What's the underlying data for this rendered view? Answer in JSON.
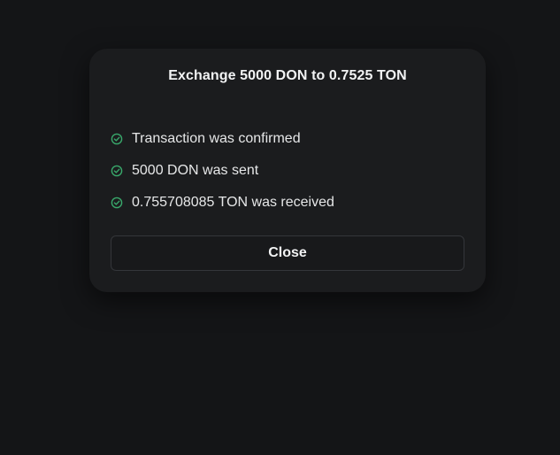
{
  "modal": {
    "title": "Exchange 5000 DON to 0.7525 TON",
    "statuses": [
      {
        "icon": "check-circle-icon",
        "text": "Transaction was confirmed"
      },
      {
        "icon": "check-circle-icon",
        "text": "5000 DON was sent"
      },
      {
        "icon": "check-circle-icon",
        "text": "0.755708085 TON was received"
      }
    ],
    "close_label": "Close"
  },
  "colors": {
    "background": "#141517",
    "modal_background": "#1b1c1e",
    "success": "#39a86b",
    "text": "#e8e9ea"
  }
}
